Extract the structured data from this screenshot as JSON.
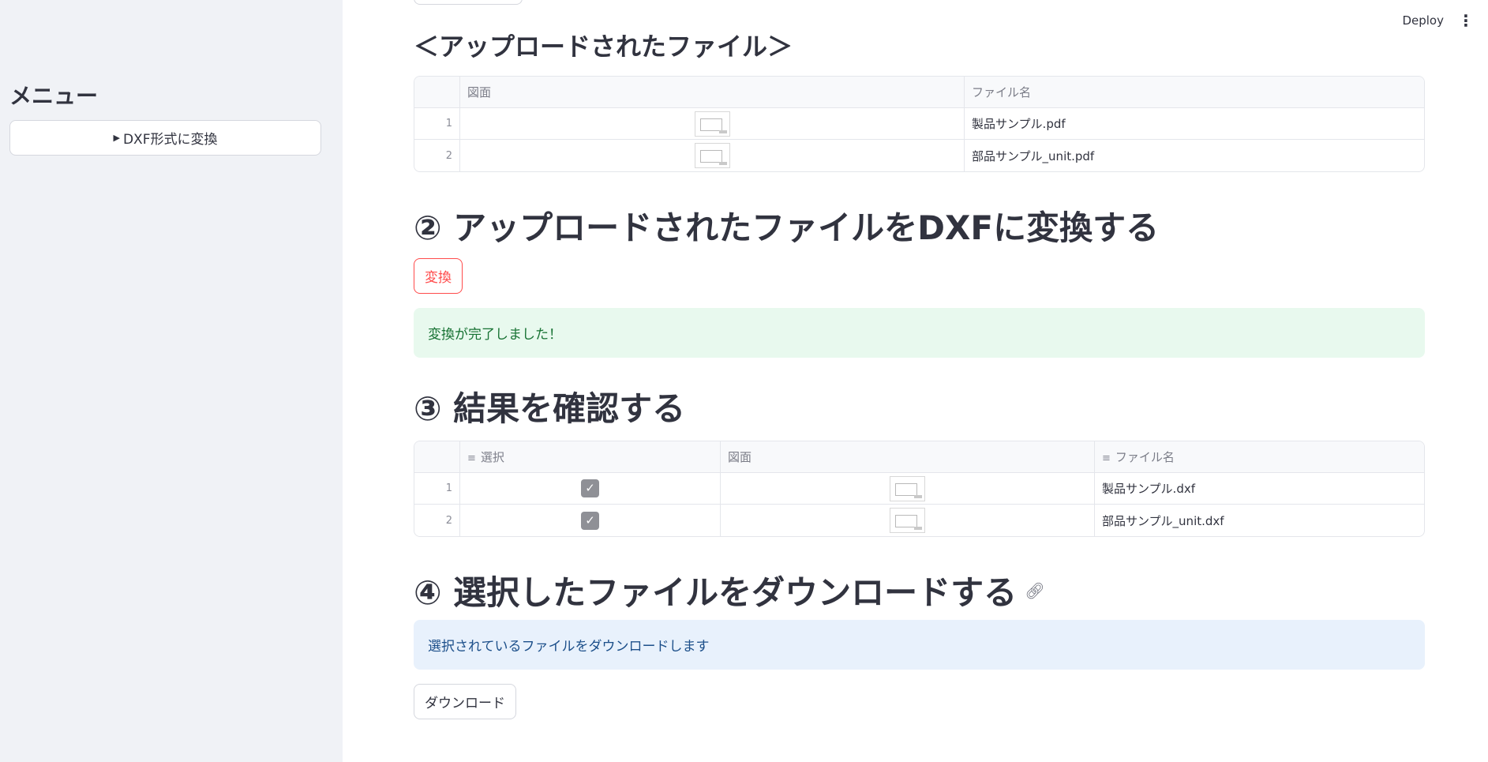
{
  "sidebar": {
    "title": "メニュー",
    "button_label": "DXF形式に変換"
  },
  "header": {
    "deploy_label": "Deploy"
  },
  "uploaded": {
    "heading": "＜アップロードされたファイル＞",
    "columns": [
      "図面",
      "ファイル名"
    ],
    "rows": [
      {
        "index": "1",
        "filename": "製品サンプル.pdf"
      },
      {
        "index": "2",
        "filename": "部品サンプル_unit.pdf"
      }
    ]
  },
  "step2": {
    "heading": "② アップロードされたファイルをDXFに変換する",
    "button_label": "変換",
    "success_message": "変換が完了しました！"
  },
  "step3": {
    "heading": "③ 結果を確認する",
    "columns": [
      "選択",
      "図面",
      "ファイル名"
    ],
    "rows": [
      {
        "index": "1",
        "selected": true,
        "filename": "製品サンプル.dxf"
      },
      {
        "index": "2",
        "selected": true,
        "filename": "部品サンプル_unit.dxf"
      }
    ]
  },
  "step4": {
    "heading": "④ 選択したファイルをダウンロードする",
    "info_message": "選択されているファイルをダウンロードします",
    "button_label": "ダウンロード"
  },
  "colors": {
    "accent": "#ff4b4b",
    "sidebar_bg": "#f0f2f6",
    "success_bg": "#e8f9ee",
    "info_bg": "#e8f1fc"
  }
}
